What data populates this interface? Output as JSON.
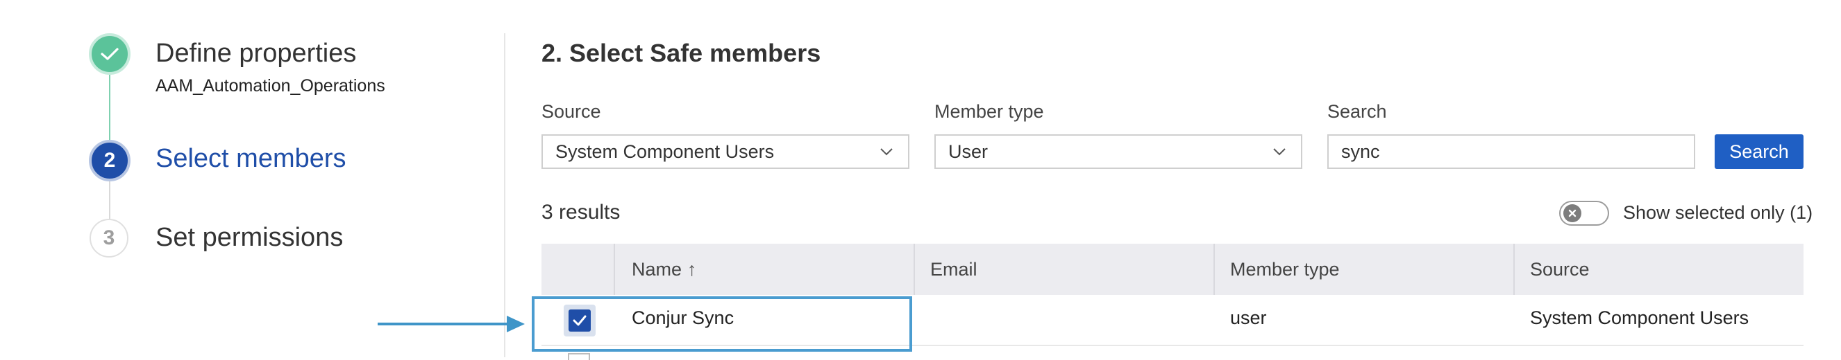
{
  "stepper": {
    "steps": [
      {
        "number": "",
        "title": "Define properties",
        "subtitle": "AAM_Automation_Operations",
        "state": "completed",
        "icon": "check-icon"
      },
      {
        "number": "2",
        "title": "Select members",
        "state": "active"
      },
      {
        "number": "3",
        "title": "Set permissions",
        "state": "pending"
      }
    ]
  },
  "main": {
    "title": "2. Select Safe members",
    "filters": {
      "source_label": "Source",
      "source_value": "System Component Users",
      "member_type_label": "Member type",
      "member_type_value": "User",
      "search_label": "Search",
      "search_value": "sync",
      "search_button": "Search"
    },
    "results_text": "3 results",
    "show_selected_label": "Show selected only (1)",
    "table": {
      "columns": [
        "Name",
        "Email",
        "Member type",
        "Source"
      ],
      "sort_indicator": "↑",
      "rows": [
        {
          "selected": true,
          "name": "Conjur Sync",
          "email": "",
          "member_type": "user",
          "source": "System Component Users"
        }
      ]
    }
  },
  "colors": {
    "accent": "#1f4ea8",
    "completed": "#5bc39a",
    "button": "#1f5fc4",
    "annotation": "#4a9cd0"
  }
}
